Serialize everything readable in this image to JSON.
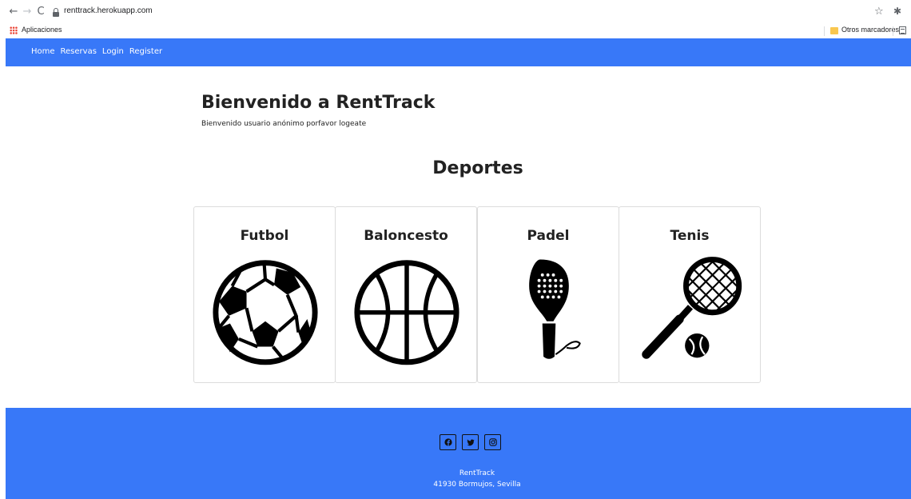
{
  "browser": {
    "url": "renttrack.herokuapp.com",
    "bookmarks": {
      "apps_label": "Aplicaciones",
      "other_label": "Otros marcadores"
    }
  },
  "navbar": {
    "color": "#3878f8",
    "links": [
      "Home",
      "Reservas",
      "Login",
      "Register"
    ]
  },
  "main": {
    "title": "Bienvenido a RentTrack",
    "subtitle": "Bienvenido usuario anónimo porfavor logeate",
    "section_title": "Deportes",
    "sports": [
      {
        "label": "Futbol",
        "icon": "soccer-ball-icon"
      },
      {
        "label": "Baloncesto",
        "icon": "basketball-icon"
      },
      {
        "label": "Padel",
        "icon": "padel-racket-icon"
      },
      {
        "label": "Tenis",
        "icon": "tennis-racket-icon"
      }
    ]
  },
  "footer": {
    "color": "#3878f8",
    "socials": [
      "facebook-icon",
      "twitter-icon",
      "instagram-icon"
    ],
    "name": "RentTrack",
    "address": "41930 Bormujos, Sevilla"
  }
}
